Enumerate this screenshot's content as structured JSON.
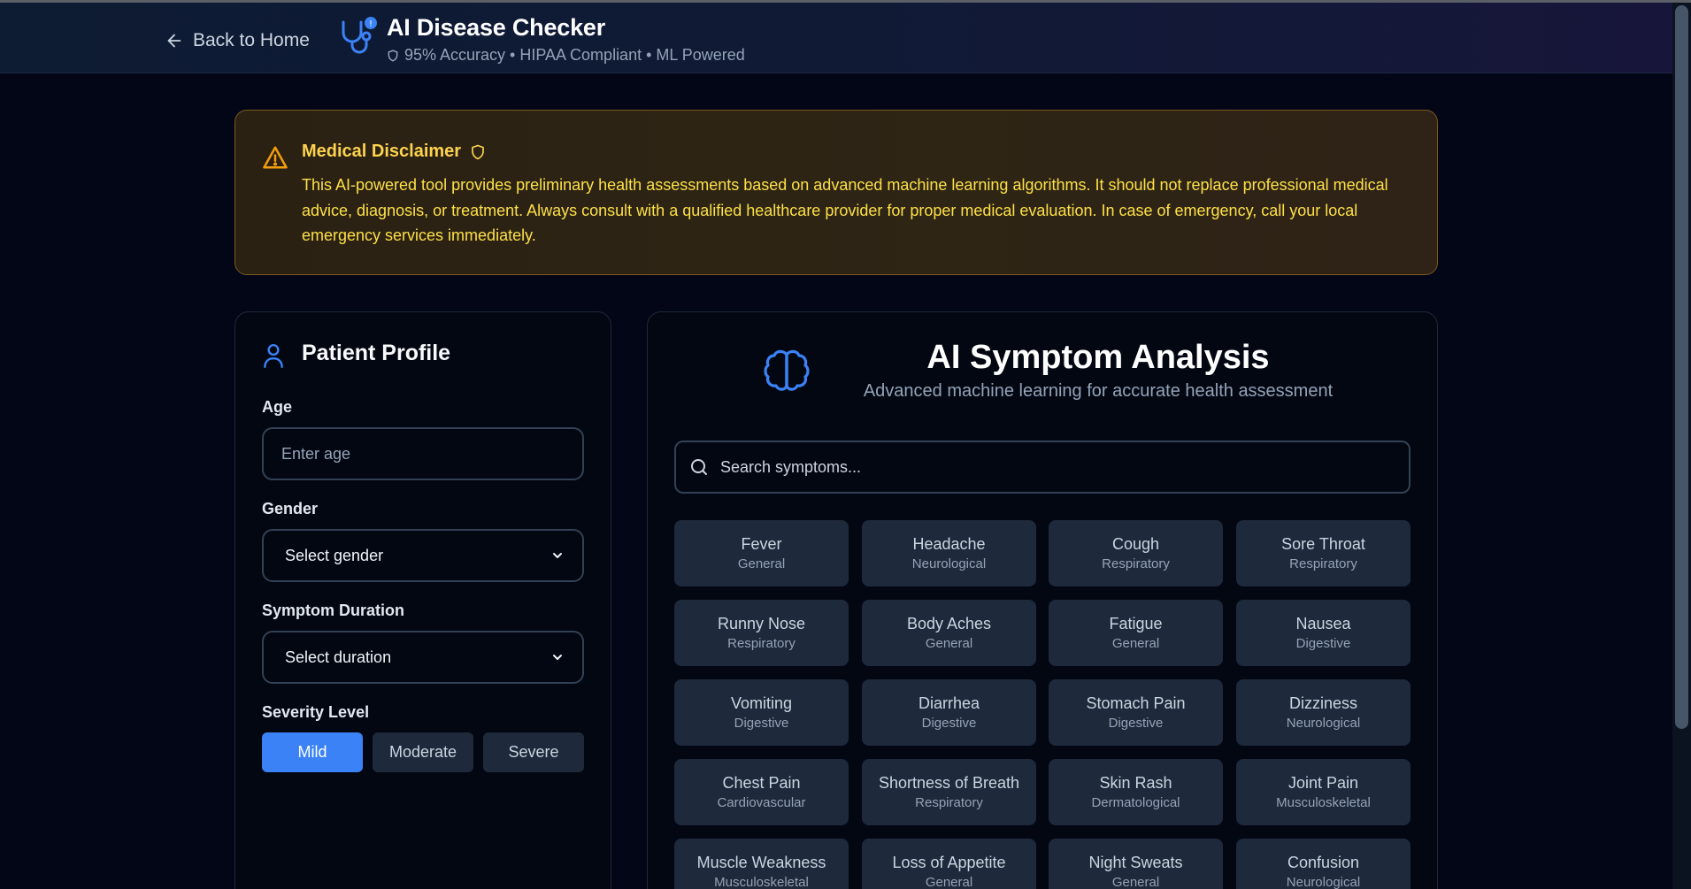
{
  "header": {
    "back_label": "Back to Home",
    "title": "AI Disease Checker",
    "subtitle": "95% Accuracy • HIPAA Compliant • ML Powered"
  },
  "disclaimer": {
    "title": "Medical Disclaimer",
    "text": "This AI-powered tool provides preliminary health assessments based on advanced machine learning algorithms. It should not replace professional medical advice, diagnosis, or treatment. Always consult with a qualified healthcare provider for proper medical evaluation. In case of emergency, call your local emergency services immediately."
  },
  "profile": {
    "title": "Patient Profile",
    "age_label": "Age",
    "age_placeholder": "Enter age",
    "age_value": "",
    "gender_label": "Gender",
    "gender_value": "Select gender",
    "duration_label": "Symptom Duration",
    "duration_value": "Select duration",
    "severity_label": "Severity Level",
    "severity_options": [
      "Mild",
      "Moderate",
      "Severe"
    ],
    "severity_selected": "Mild"
  },
  "analysis": {
    "title": "AI Symptom Analysis",
    "subtitle": "Advanced machine learning for accurate health assessment",
    "search_placeholder": "Search symptoms...",
    "symptoms": [
      {
        "name": "Fever",
        "category": "General"
      },
      {
        "name": "Headache",
        "category": "Neurological"
      },
      {
        "name": "Cough",
        "category": "Respiratory"
      },
      {
        "name": "Sore Throat",
        "category": "Respiratory"
      },
      {
        "name": "Runny Nose",
        "category": "Respiratory"
      },
      {
        "name": "Body Aches",
        "category": "General"
      },
      {
        "name": "Fatigue",
        "category": "General"
      },
      {
        "name": "Nausea",
        "category": "Digestive"
      },
      {
        "name": "Vomiting",
        "category": "Digestive"
      },
      {
        "name": "Diarrhea",
        "category": "Digestive"
      },
      {
        "name": "Stomach Pain",
        "category": "Digestive"
      },
      {
        "name": "Dizziness",
        "category": "Neurological"
      },
      {
        "name": "Chest Pain",
        "category": "Cardiovascular"
      },
      {
        "name": "Shortness of Breath",
        "category": "Respiratory"
      },
      {
        "name": "Skin Rash",
        "category": "Dermatological"
      },
      {
        "name": "Joint Pain",
        "category": "Musculoskeletal"
      },
      {
        "name": "Muscle Weakness",
        "category": "Musculoskeletal"
      },
      {
        "name": "Loss of Appetite",
        "category": "General"
      },
      {
        "name": "Night Sweats",
        "category": "General"
      },
      {
        "name": "Confusion",
        "category": "Neurological"
      }
    ]
  },
  "icons": {
    "back": "arrow-left-icon",
    "brand": "stethoscope-icon",
    "shield": "shield-icon",
    "warning": "warning-triangle-icon",
    "user": "user-icon",
    "chevron": "chevron-down-icon",
    "brain": "brain-icon",
    "search": "search-icon"
  },
  "colors": {
    "accent": "#3b82f6",
    "warning_text": "#fde047",
    "warning_title": "#fcd34d",
    "background": "#020617",
    "tile": "#1e293b"
  }
}
